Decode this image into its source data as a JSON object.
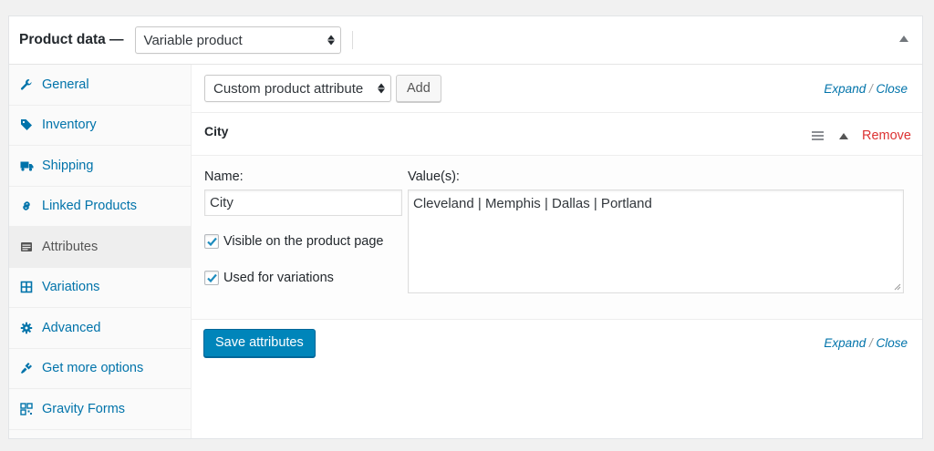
{
  "header": {
    "title": "Product data —",
    "product_type": "Variable product"
  },
  "tabs": [
    {
      "label": "General",
      "icon": "wrench-icon"
    },
    {
      "label": "Inventory",
      "icon": "tag-icon"
    },
    {
      "label": "Shipping",
      "icon": "truck-icon"
    },
    {
      "label": "Linked Products",
      "icon": "link-icon"
    },
    {
      "label": "Attributes",
      "icon": "list-icon"
    },
    {
      "label": "Variations",
      "icon": "grid-icon"
    },
    {
      "label": "Advanced",
      "icon": "gear-icon"
    },
    {
      "label": "Get more options",
      "icon": "plugin-icon"
    },
    {
      "label": "Gravity Forms",
      "icon": "form-icon"
    }
  ],
  "active_tab": "Attributes",
  "toolbar": {
    "attribute_select": "Custom product attribute",
    "add_label": "Add",
    "expand_label": "Expand",
    "separator": " / ",
    "close_label": "Close"
  },
  "attribute": {
    "title": "City",
    "remove_label": "Remove",
    "name_label": "Name:",
    "name_value": "City",
    "values_label": "Value(s):",
    "values_value": "Cleveland | Memphis | Dallas | Portland",
    "visible_label": "Visible on the product page",
    "visible_checked": true,
    "variations_label": "Used for variations",
    "variations_checked": true
  },
  "footer": {
    "save_label": "Save attributes",
    "expand_label": "Expand",
    "separator": " / ",
    "close_label": "Close"
  },
  "colors": {
    "link": "#0073aa",
    "remove": "#dc3232",
    "primary_button": "#0085ba"
  }
}
